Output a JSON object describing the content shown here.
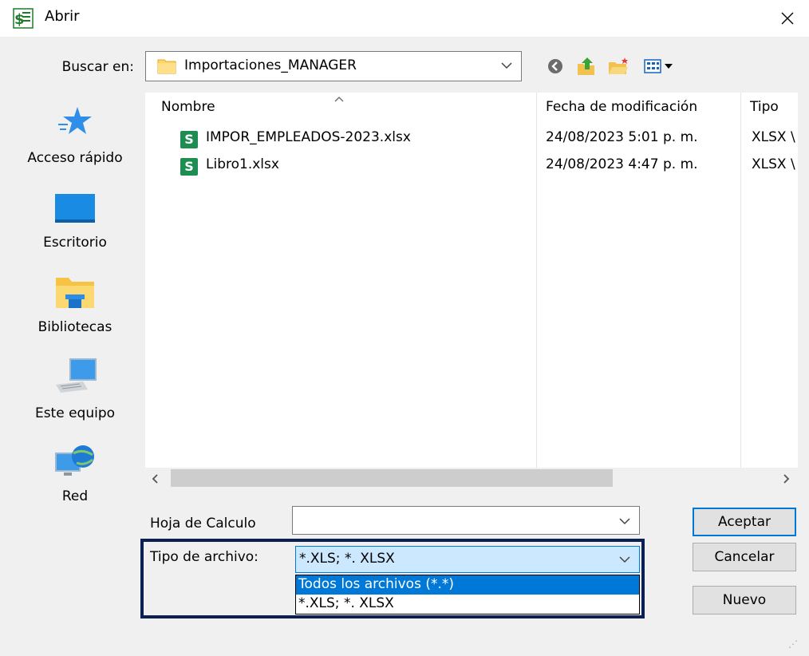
{
  "window": {
    "title": "Abrir"
  },
  "lookin": {
    "label": "Buscar en:",
    "value": "Importaciones_MANAGER"
  },
  "places": [
    {
      "label": "Acceso rápido"
    },
    {
      "label": "Escritorio"
    },
    {
      "label": "Bibliotecas"
    },
    {
      "label": "Este equipo"
    },
    {
      "label": "Red"
    }
  ],
  "filelist": {
    "columns": [
      "Nombre",
      "Fecha de modificación",
      "Tipo"
    ],
    "rows": [
      {
        "name": "IMPOR_EMPLEADOS-2023.xlsx",
        "date": "24/08/2023 5:01 p. m.",
        "type": "XLSX \\"
      },
      {
        "name": "Libro1.xlsx",
        "date": "24/08/2023 4:47 p. m.",
        "type": "XLSX \\"
      }
    ],
    "icon_letter": "S"
  },
  "filename": {
    "label": "Hoja de Calculo",
    "value": ""
  },
  "filetype": {
    "label": "Tipo de archivo:",
    "value": "*.XLS; *. XLSX",
    "options": [
      "Todos los archivos (*.*)",
      "*.XLS; *. XLSX"
    ]
  },
  "buttons": {
    "accept": "Aceptar",
    "cancel": "Cancelar",
    "new": "Nuevo"
  },
  "colors": {
    "accent": "#0078d7",
    "sheet_green": "#1e8d51",
    "highlight_border": "#0a1f52"
  }
}
